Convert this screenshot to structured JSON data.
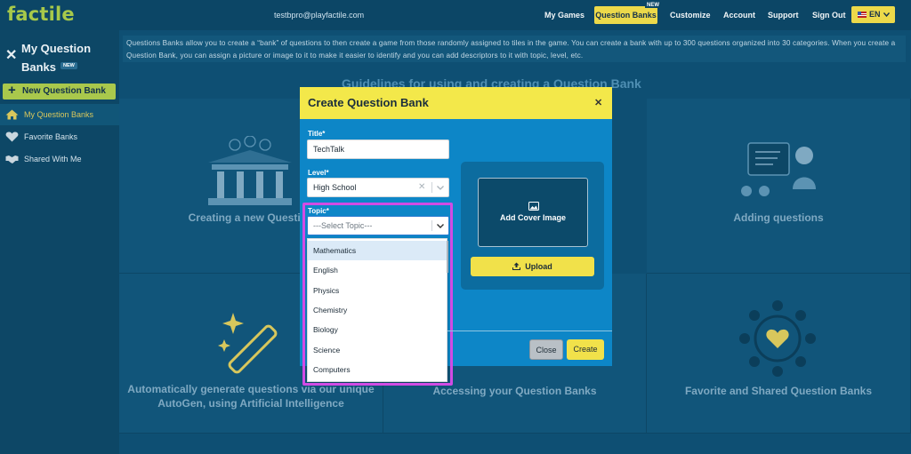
{
  "app": {
    "logo": "factile"
  },
  "header": {
    "email": "testbpro@playfactile.com",
    "nav": [
      {
        "label": "My Games"
      },
      {
        "label": "Question Banks",
        "badge": "NEW",
        "active": true
      },
      {
        "label": "Customize"
      },
      {
        "label": "Account"
      },
      {
        "label": "Support"
      },
      {
        "label": "Sign Out"
      }
    ],
    "language": "EN"
  },
  "sidebar": {
    "title": "My Question Banks",
    "title_badge": "NEW",
    "new_button": "New Question Bank",
    "items": [
      {
        "label": "My Question Banks",
        "icon": "home-icon",
        "active": true
      },
      {
        "label": "Favorite Banks",
        "icon": "heart-icon"
      },
      {
        "label": "Shared With Me",
        "icon": "handshake-icon"
      }
    ]
  },
  "main": {
    "info_text": "Questions Banks allow you to create a “bank” of questions to then create a game from those randomly assigned to tiles in the game. You can create a bank with up to 300 questions organized into 30 categories. When you create a Question Bank, you can assign a picture or image to it to make it easier to identify and you can add descriptors to it with topic, level, etc.",
    "guidelines_title": "Guidelines for using and creating a Question Bank",
    "cards": [
      {
        "label": "Creating a new Question"
      },
      {
        "label": "Adding questions"
      },
      {
        "label": "Automatically generate questions via our unique AutoGen, using Artificial Intelligence"
      },
      {
        "label": "Accessing your Question Banks"
      },
      {
        "label": "Favorite and Shared Question Banks"
      }
    ]
  },
  "modal": {
    "title": "Create Question Bank",
    "title_label": "Title*",
    "title_value": "TechTalk",
    "level_label": "Level*",
    "level_value": "High School",
    "topic_label": "Topic*",
    "topic_placeholder": "---Select Topic---",
    "topic_options": [
      "Mathematics",
      "English",
      "Physics",
      "Chemistry",
      "Biology",
      "Science",
      "Computers"
    ],
    "highlighted_option": "Mathematics",
    "cover_label": "Add Cover Image",
    "upload_label": "Upload",
    "close_label": "Close",
    "create_label": "Create"
  },
  "colors": {
    "accent_yellow": "#f3e84a",
    "green": "#a9c84c",
    "modal_blue": "#0d86c7",
    "highlight": "#d14be4"
  }
}
